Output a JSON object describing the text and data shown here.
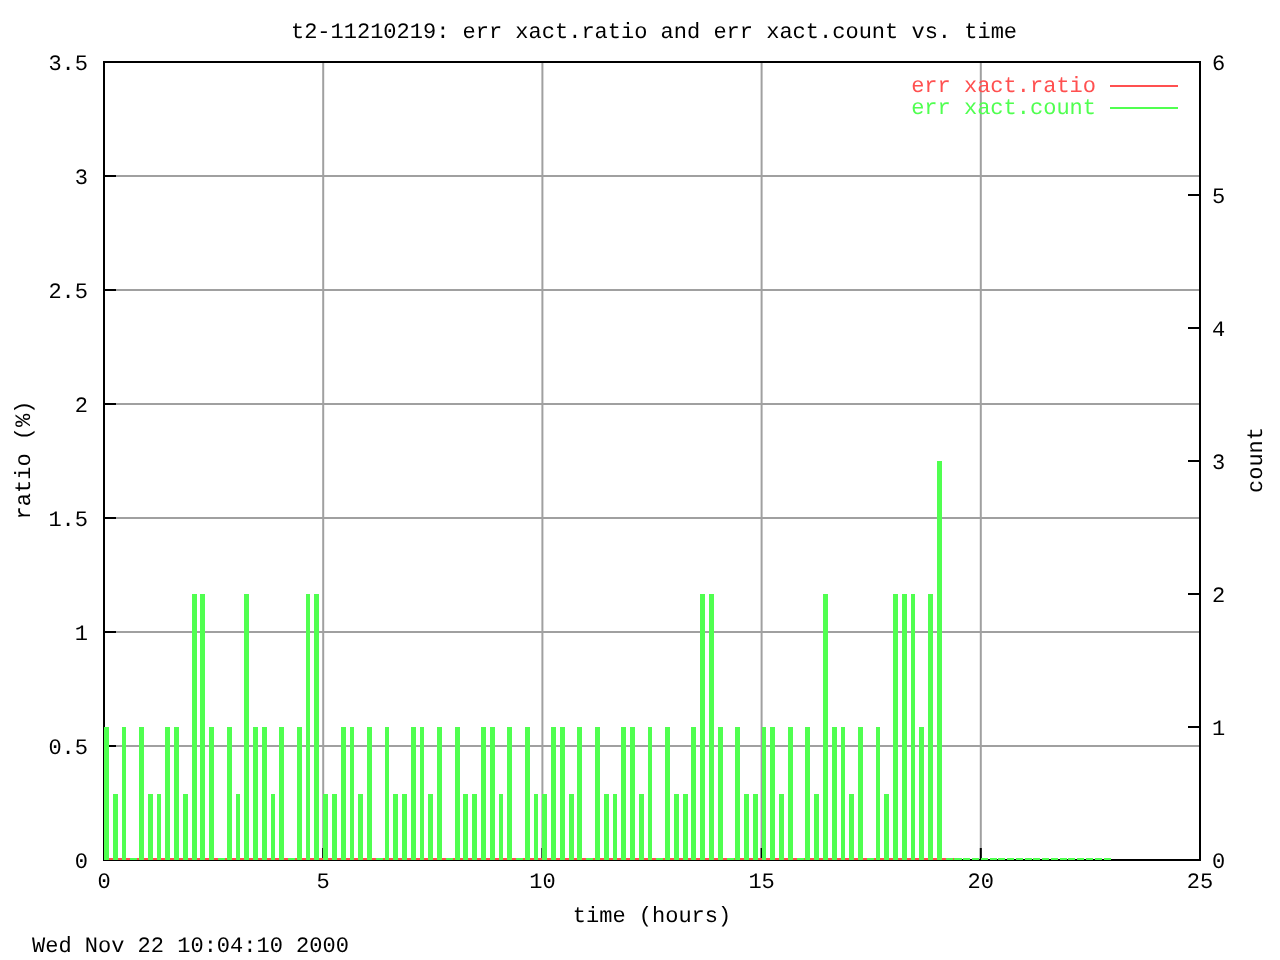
{
  "plot": {
    "chart_data": {
      "type": "line",
      "title": "t2-11210219: err xact.ratio and err xact.count vs. time",
      "xlabel": "time (hours)",
      "ylabel": "ratio (%)",
      "y2label": "count",
      "grid": true,
      "legend": true,
      "xlim": [
        0,
        25
      ],
      "ylim": [
        0,
        3.5
      ],
      "y2lim": [
        0,
        6
      ],
      "xticks": [
        0,
        5,
        10,
        15,
        20,
        25
      ],
      "yticks": [
        0,
        0.5,
        1,
        1.5,
        2,
        2.5,
        3,
        3.5
      ],
      "y2ticks": [
        0,
        1,
        2,
        3,
        4,
        5,
        6
      ],
      "x": [
        0,
        0.2,
        0.4,
        0.6,
        0.8,
        1,
        1.2,
        1.4,
        1.6,
        1.8,
        2,
        2.2,
        2.4,
        2.6,
        2.8,
        3,
        3.2,
        3.4,
        3.6,
        3.8,
        4,
        4.2,
        4.4,
        4.6,
        4.8,
        5,
        5.2,
        5.4,
        5.6,
        5.8,
        6,
        6.2,
        6.4,
        6.6,
        6.8,
        7,
        7.2,
        7.4,
        7.6,
        7.8,
        8,
        8.2,
        8.4,
        8.6,
        8.8,
        9,
        9.2,
        9.4,
        9.6,
        9.8,
        10,
        10.2,
        10.4,
        10.6,
        10.8,
        11,
        11.2,
        11.4,
        11.6,
        11.8,
        12,
        12.2,
        12.4,
        12.6,
        12.8,
        13,
        13.2,
        13.4,
        13.6,
        13.8,
        14,
        14.2,
        14.4,
        14.6,
        14.8,
        15,
        15.2,
        15.4,
        15.6,
        15.8,
        16,
        16.2,
        16.4,
        16.6,
        16.8,
        17,
        17.2,
        17.4,
        17.6,
        17.8,
        18,
        18.2,
        18.4,
        18.6,
        18.8,
        19,
        19.2,
        19.4,
        19.6,
        19.8,
        20,
        20.2,
        20.4,
        20.6,
        20.8,
        21,
        21.2,
        21.4,
        21.6,
        21.8,
        22,
        22.2,
        22.4,
        22.6,
        22.8
      ],
      "series": [
        {
          "name": "err xact.ratio",
          "color": "#ff5050",
          "values": [
            0,
            0,
            0,
            0,
            0,
            0,
            0,
            0,
            0,
            0,
            0,
            0,
            0,
            0,
            0,
            0,
            0,
            0,
            0,
            0,
            0,
            0,
            0,
            0,
            0,
            0,
            0,
            0,
            0,
            0,
            0,
            0,
            0,
            0,
            0,
            0,
            0,
            0,
            0,
            0,
            0,
            0,
            0,
            0,
            0,
            0,
            0,
            0,
            0,
            0,
            0,
            0,
            0,
            0,
            0,
            0,
            0,
            0,
            0,
            0,
            0,
            0,
            0,
            0,
            0,
            0,
            0,
            0,
            0,
            0,
            0,
            0,
            0,
            0,
            0,
            0,
            0,
            0,
            0,
            0,
            0,
            0,
            0,
            0,
            0,
            0,
            0,
            0,
            0,
            0,
            0,
            0,
            0,
            0,
            0,
            0,
            0,
            0,
            null,
            null,
            null,
            null,
            null,
            null,
            null,
            null,
            null,
            null,
            null,
            null,
            null,
            null,
            null,
            null,
            null
          ]
        },
        {
          "name": "err xact.count",
          "color": "#50ff50",
          "axis": "y2",
          "type": "bar",
          "values": [
            1,
            0.5,
            1,
            0,
            1,
            0.5,
            0.5,
            1,
            1,
            0.5,
            2,
            2,
            1,
            0,
            1,
            0.5,
            2,
            1,
            1,
            0.5,
            1,
            0,
            1,
            2,
            2,
            0.5,
            0.5,
            1,
            1,
            0.5,
            1,
            0,
            1,
            0.5,
            0.5,
            1,
            1,
            0.5,
            1,
            0,
            1,
            0.5,
            0.5,
            1,
            1,
            0.5,
            1,
            0,
            1,
            0.5,
            0.5,
            1,
            1,
            0.5,
            1,
            0,
            1,
            0.5,
            0.5,
            1,
            1,
            0.5,
            1,
            0,
            1,
            0.5,
            0.5,
            1,
            2,
            2,
            1,
            0,
            1,
            0.5,
            0.5,
            1,
            1,
            0.5,
            1,
            0,
            1,
            0.5,
            2,
            1,
            1,
            0.5,
            1,
            0,
            1,
            0.5,
            2,
            2,
            2,
            1,
            2,
            3,
            0,
            0,
            0,
            0,
            0,
            0,
            0,
            0,
            0,
            0,
            0,
            0,
            0,
            0,
            0,
            0,
            0,
            0,
            0
          ]
        }
      ]
    }
  },
  "timestamp": "Wed Nov 22 10:04:10 2000"
}
